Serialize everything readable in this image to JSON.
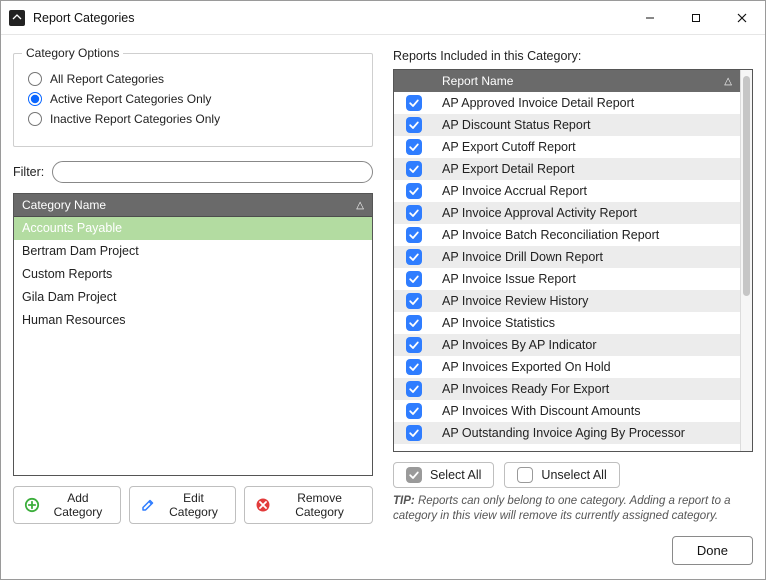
{
  "window": {
    "title": "Report Categories"
  },
  "left": {
    "group_title": "Category Options",
    "radios": {
      "all": {
        "label": "All Report Categories",
        "checked": false
      },
      "active": {
        "label": "Active Report Categories Only",
        "checked": true
      },
      "inactive": {
        "label": "Inactive Report Categories Only",
        "checked": false
      }
    },
    "filter_label": "Filter:",
    "filter_value": "",
    "category_header": "Category Name",
    "categories": [
      {
        "name": "Accounts Payable",
        "selected": true
      },
      {
        "name": "Bertram Dam Project",
        "selected": false
      },
      {
        "name": "Custom Reports",
        "selected": false
      },
      {
        "name": "Gila Dam Project",
        "selected": false
      },
      {
        "name": "Human Resources",
        "selected": false
      }
    ],
    "buttons": {
      "add": "Add Category",
      "edit": "Edit Category",
      "remove": "Remove Category"
    }
  },
  "right": {
    "title": "Reports Included in this Category:",
    "column_header": "Report Name",
    "reports": [
      "AP Approved Invoice Detail Report",
      "AP Discount Status Report",
      "AP Export Cutoff Report",
      "AP Export Detail Report",
      "AP Invoice Accrual Report",
      "AP Invoice Approval Activity Report",
      "AP Invoice Batch Reconciliation Report",
      "AP Invoice Drill Down Report",
      "AP Invoice Issue Report",
      "AP Invoice Review History",
      "AP Invoice Statistics",
      "AP Invoices By AP Indicator",
      "AP Invoices Exported On Hold",
      "AP Invoices Ready For Export",
      "AP Invoices With Discount Amounts",
      "AP Outstanding Invoice Aging By Processor"
    ],
    "select_all": "Select All",
    "unselect_all": "Unselect All",
    "tip_label": "TIP:",
    "tip_text": "Reports can only belong to one category.  Adding a report to a category in this view will remove its currently assigned category."
  },
  "footer": {
    "done": "Done"
  }
}
